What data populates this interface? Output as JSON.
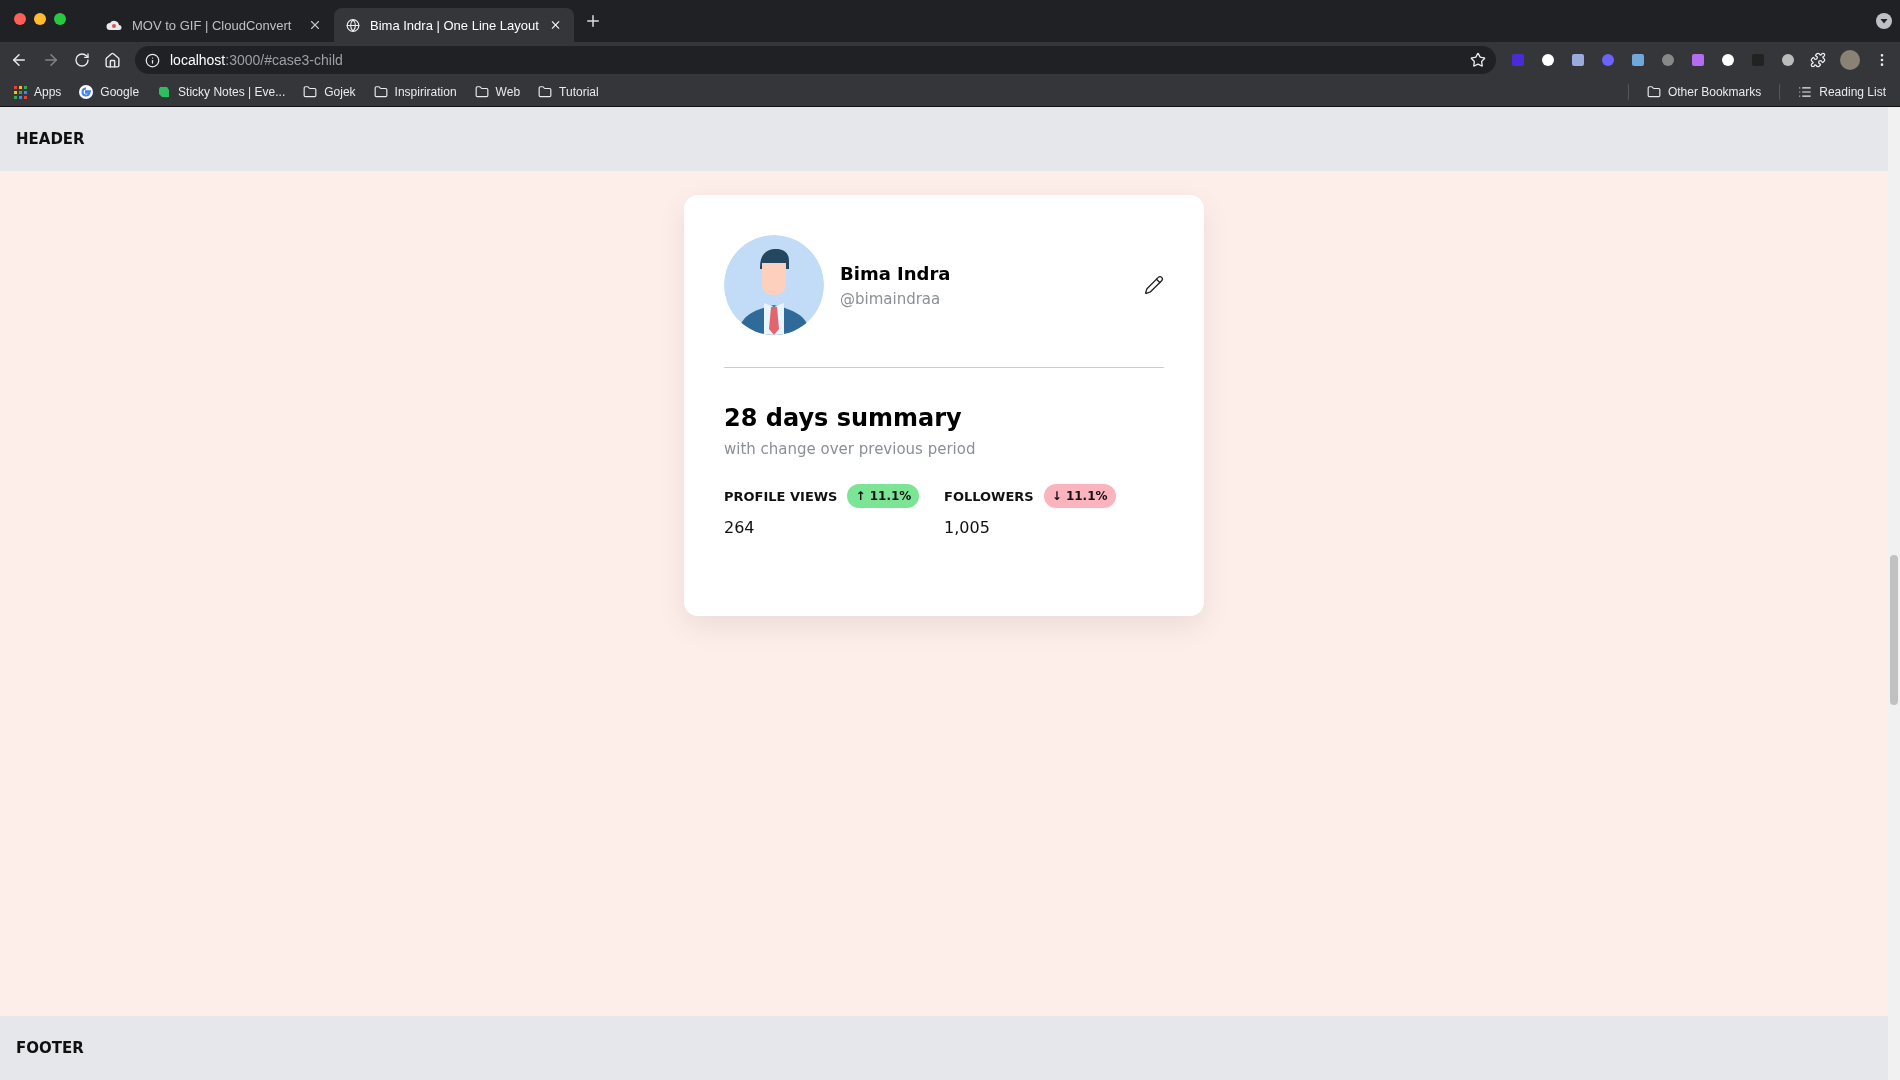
{
  "browser": {
    "tabs": [
      {
        "title": "MOV to GIF | CloudConvert",
        "selected": false,
        "kind": "cloud"
      },
      {
        "title": "Bima Indra | One Line Layout",
        "selected": true,
        "kind": "globe"
      }
    ],
    "address": {
      "host": "localhost",
      "rest": ":3000/#case3-child"
    },
    "bookmarks": [
      {
        "label": "Apps",
        "kind": "apps"
      },
      {
        "label": "Google",
        "kind": "google"
      },
      {
        "label": "Sticky Notes | Eve...",
        "kind": "note"
      },
      {
        "label": "Gojek",
        "kind": "folder"
      },
      {
        "label": "Inspiriration",
        "kind": "folder"
      },
      {
        "label": "Web",
        "kind": "folder"
      },
      {
        "label": "Tutorial",
        "kind": "folder"
      }
    ],
    "other_bookmarks": "Other Bookmarks",
    "reading_list": "Reading List"
  },
  "header": "HEADER",
  "profile": {
    "name": "Bima Indra",
    "handle": "@bimaindraa"
  },
  "summary": {
    "title": "28 days summary",
    "subtitle": "with change over previous period"
  },
  "stats": [
    {
      "label": "PROFILE VIEWS",
      "badge": "↑ 11.1%",
      "color": "#7be495",
      "value": "264"
    },
    {
      "label": "FOLLOWERS",
      "badge": "↓ 11.1%",
      "color": "#fbb4bd",
      "value": "1,005"
    }
  ],
  "footer": "FOOTER"
}
